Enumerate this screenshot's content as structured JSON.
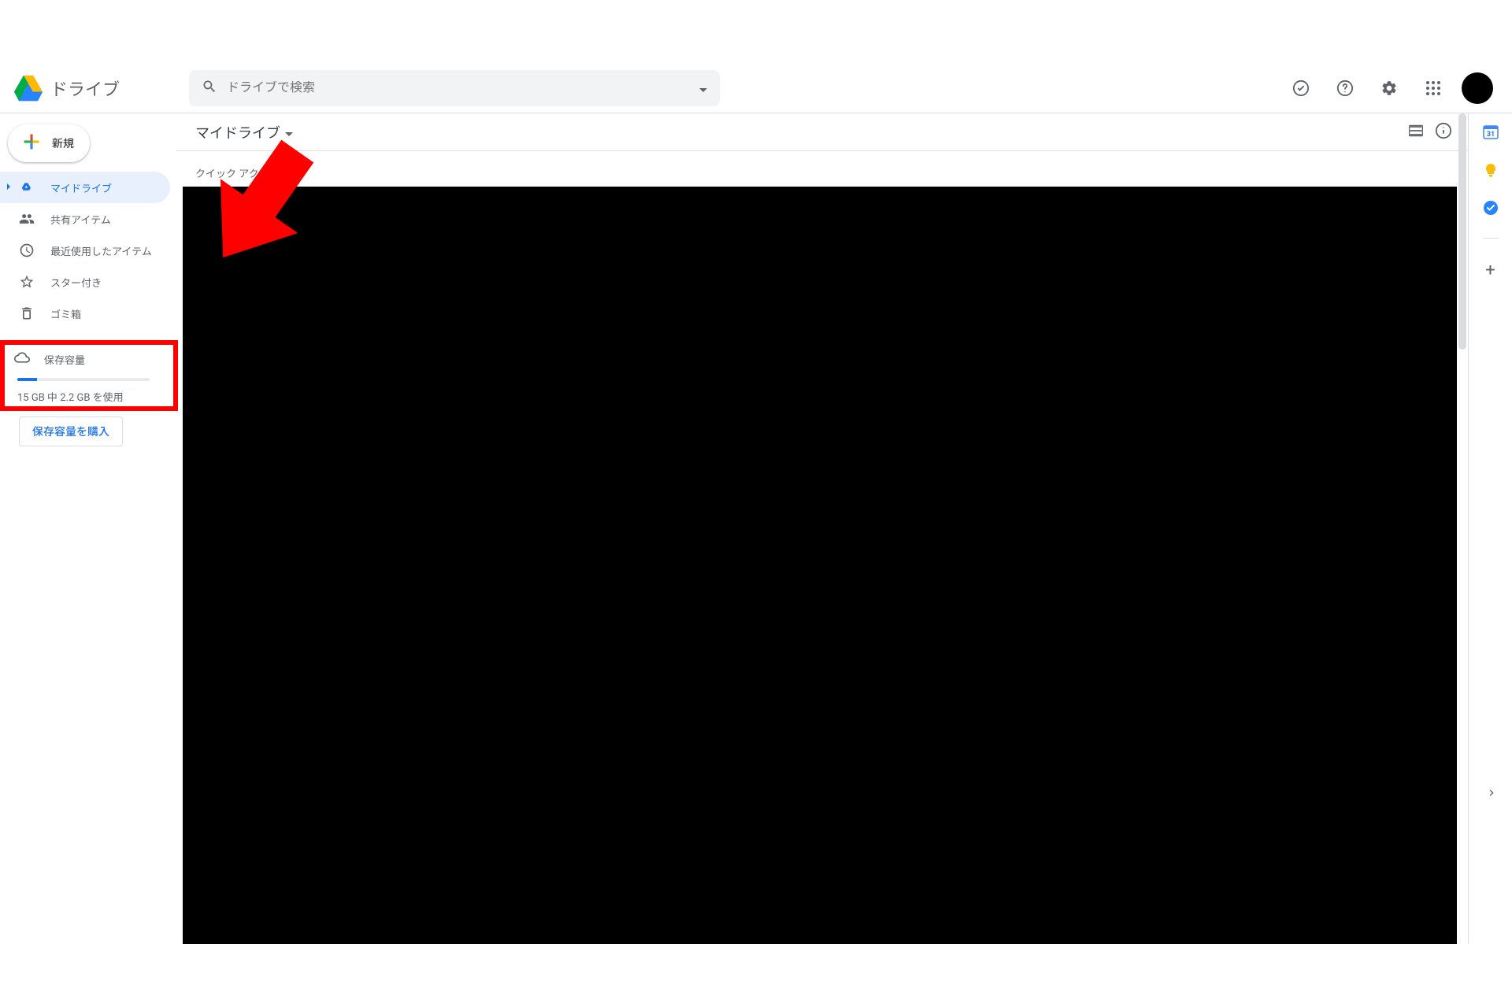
{
  "header": {
    "app_title": "ドライブ",
    "search_placeholder": "ドライブで検索"
  },
  "sidebar": {
    "new_label": "新規",
    "items": [
      {
        "label": "マイドライブ"
      },
      {
        "label": "共有アイテム"
      },
      {
        "label": "最近使用したアイテム"
      },
      {
        "label": "スター付き"
      },
      {
        "label": "ゴミ箱"
      }
    ],
    "storage": {
      "label": "保存容量",
      "usage_text": "15 GB 中 2.2 GB を使用",
      "buy_label": "保存容量を購入",
      "percent_used": 15
    }
  },
  "main": {
    "breadcrumb": "マイドライブ",
    "quick_access": "クイック アクセス"
  }
}
